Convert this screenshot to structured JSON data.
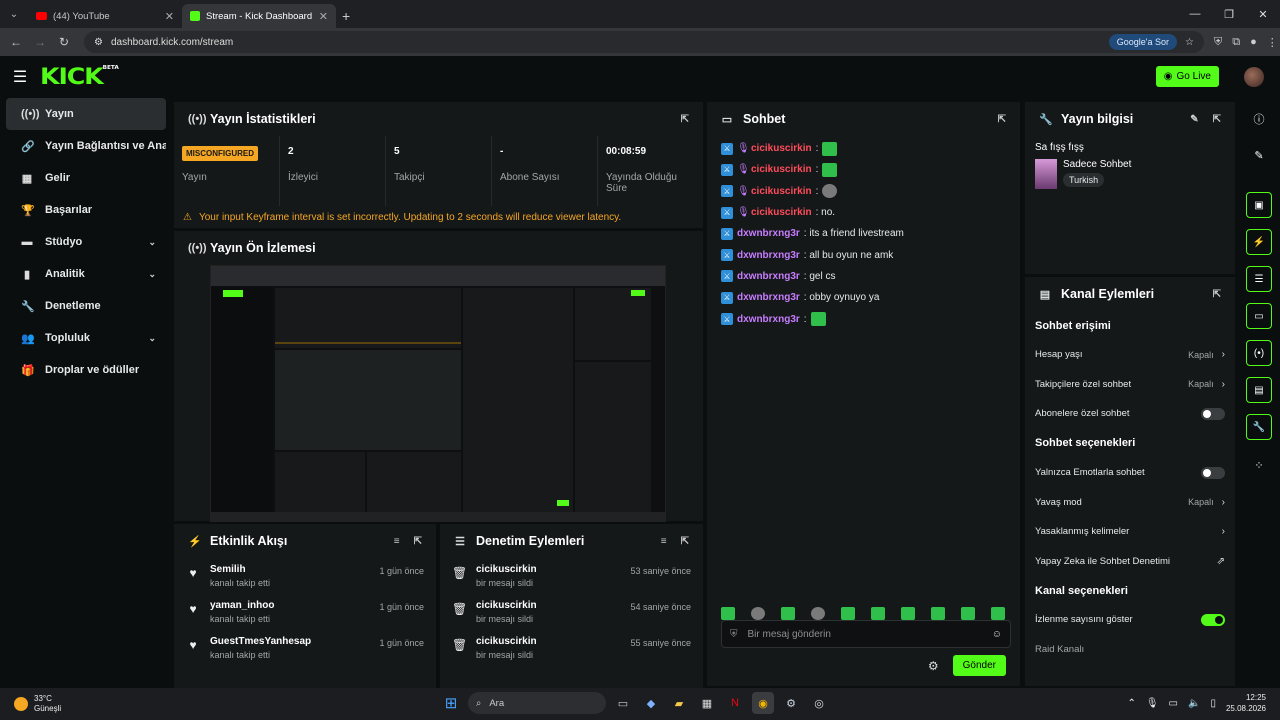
{
  "browser": {
    "tabs": [
      {
        "label": "(44) YouTube"
      },
      {
        "label": "Stream - Kick Dashboard"
      }
    ],
    "url": "dashboard.kick.com/stream",
    "google_button": "Google'a Sor"
  },
  "header": {
    "logo": "KICK",
    "logo_badge": "BETA",
    "go_live": "Go Live"
  },
  "sidebar": {
    "items": [
      {
        "label": "Yayın",
        "icon": "broadcast-icon"
      },
      {
        "label": "Yayın Bağlantısı ve Anahtarı",
        "icon": "link-icon"
      },
      {
        "label": "Gelir",
        "icon": "revenue-icon"
      },
      {
        "label": "Başarılar",
        "icon": "trophy-icon"
      },
      {
        "label": "Stüdyo",
        "icon": "studio-icon"
      },
      {
        "label": "Analitik",
        "icon": "analytics-icon"
      },
      {
        "label": "Denetleme",
        "icon": "wrench-icon"
      },
      {
        "label": "Topluluk",
        "icon": "community-icon"
      },
      {
        "label": "Droplar ve ödüller",
        "icon": "gift-icon"
      }
    ]
  },
  "stats": {
    "title": "Yayın İstatistikleri",
    "badge": "MISCONFIGURED",
    "status_label": "Yayın",
    "viewers_value": "2",
    "viewers_label": "İzleyici",
    "followers_value": "5",
    "followers_label": "Takipçi",
    "subs_value": "-",
    "subs_label": "Abone Sayısı",
    "uptime_value": "00:08:59",
    "uptime_label": "Yayında Olduğu Süre",
    "warning": "Your input Keyframe interval is set incorrectly. Updating to 2 seconds will reduce viewer latency."
  },
  "preview": {
    "title": "Yayın Ön İzlemesi"
  },
  "activity": {
    "title": "Etkinlik Akışı",
    "items": [
      {
        "name": "Semilih",
        "sub": "kanalı takip etti",
        "time": "1 gün önce"
      },
      {
        "name": "yaman_inhoo",
        "sub": "kanalı takip etti",
        "time": "1 gün önce"
      },
      {
        "name": "GuestTmesYanhesap",
        "sub": "kanalı takip etti",
        "time": "1 gün önce"
      }
    ]
  },
  "moderation": {
    "title": "Denetim Eylemleri",
    "items": [
      {
        "name": "cicikuscirkin",
        "sub": "bir mesajı sildi",
        "time": "53 saniye önce"
      },
      {
        "name": "cicikuscirkin",
        "sub": "bir mesajı sildi",
        "time": "54 saniye önce"
      },
      {
        "name": "cicikuscirkin",
        "sub": "bir mesajı sildi",
        "time": "55 saniye önce"
      }
    ]
  },
  "chat": {
    "title": "Sohbet",
    "messages": [
      {
        "user": "cicikuscirkin",
        "text": ":"
      },
      {
        "user": "cicikuscirkin",
        "text": ":"
      },
      {
        "user": "cicikuscirkin",
        "text": ":"
      },
      {
        "user": "cicikuscirkin",
        "text": ": no."
      },
      {
        "user": "dxwnbrxng3r",
        "text": ": its a friend livestream"
      },
      {
        "user": "dxwnbrxng3r",
        "text": ": all bu oyun ne amk"
      },
      {
        "user": "dxwnbrxng3r",
        "text": ": gel cs"
      },
      {
        "user": "dxwnbrxng3r",
        "text": ": obby oynuyo ya"
      },
      {
        "user": "dxwnbrxng3r",
        "text": ":"
      }
    ],
    "input_placeholder": "Bir mesaj gönderin",
    "send": "Gönder"
  },
  "stream_info": {
    "title": "Yayın bilgisi",
    "stream_title": "Sa fışş fışş",
    "category": "Sadece Sohbet",
    "language": "Turkish"
  },
  "channel_actions": {
    "title": "Kanal Eylemleri",
    "chat_access_title": "Sohbet erişimi",
    "account_age": "Hesap yaşı",
    "account_age_val": "Kapalı",
    "followers_only": "Takipçilere özel sohbet",
    "followers_only_val": "Kapalı",
    "subs_only": "Abonelere özel sohbet",
    "chat_options_title": "Sohbet seçenekleri",
    "emotes_only": "Yalnızca Emotlarla sohbet",
    "slow_mode": "Yavaş mod",
    "slow_mode_val": "Kapalı",
    "banned_words": "Yasaklanmış kelimeler",
    "ai_moderation": "Yapay Zeka ile Sohbet Denetimi",
    "channel_options_title": "Kanal seçenekleri",
    "show_viewers": "İzlenme sayısını göster",
    "raid": "Raid Kanalı"
  },
  "taskbar": {
    "temp": "33°C",
    "weather": "Güneşli",
    "search": "Ara",
    "time": "12:25",
    "date": "25.08.2026"
  },
  "colors": {
    "accent": "#53fc18",
    "warning": "#f5a623",
    "mod_badge": "#2f8fd8"
  }
}
